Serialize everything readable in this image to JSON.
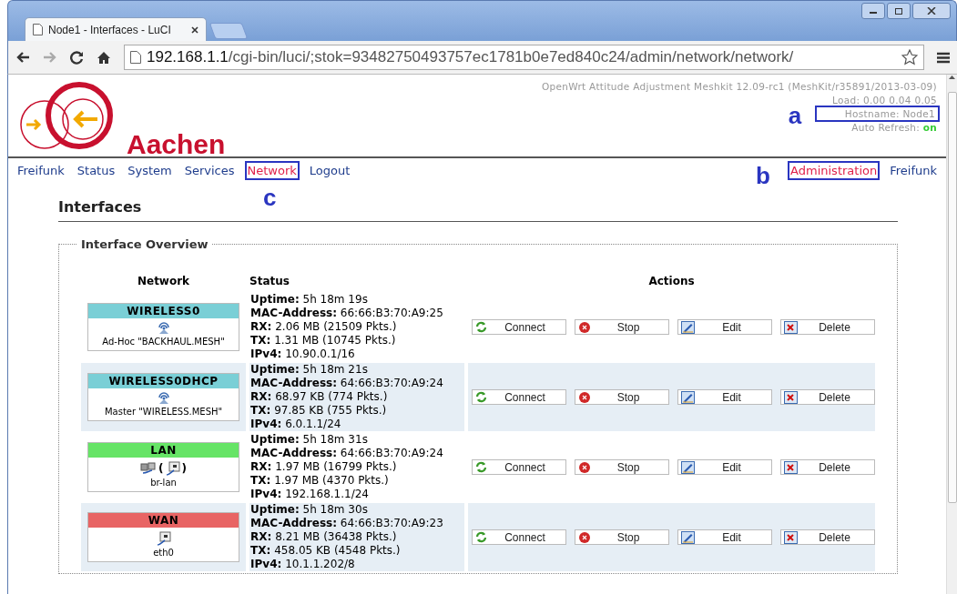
{
  "browser": {
    "tab_title": "Node1 - Interfaces - LuCI",
    "url_host": "192.168.1.1",
    "url_path": "/cgi-bin/luci/;stok=93482750493757ec1781b0e7ed840c24/admin/network/network/"
  },
  "header": {
    "logo_text": "Aachen",
    "release": "OpenWrt Attitude Adjustment Meshkit 12.09-rc1 (MeshKit/r35891/2013-03-09)",
    "load": "Load: 0.00 0.04 0.05",
    "hostname": "Hostname: Node1",
    "hostname_annotation": "a",
    "auto_refresh_label": "Auto Refresh:",
    "auto_refresh_value": "on"
  },
  "menu": {
    "left": [
      {
        "label": "Freifunk",
        "selected": false
      },
      {
        "label": "Status",
        "selected": false
      },
      {
        "label": "System",
        "selected": false
      },
      {
        "label": "Services",
        "selected": false
      },
      {
        "label": "Network",
        "selected": true,
        "annotation": "c"
      },
      {
        "label": "Logout",
        "selected": false
      }
    ],
    "right": [
      {
        "label": "Administration",
        "selected": true,
        "annotation": "b"
      },
      {
        "label": "Freifunk",
        "selected": false
      }
    ]
  },
  "page_title": "Interfaces",
  "section": {
    "legend": "Interface Overview",
    "columns": [
      "Network",
      "Status",
      "Actions"
    ],
    "rows": [
      {
        "name": "WIRELESS0",
        "color": "#7acfd6",
        "device": [
          {
            "kind": "wifi"
          }
        ],
        "subtitle": "Ad-Hoc \"BACKHAUL.MESH\"",
        "status": [
          {
            "label": "Uptime:",
            "value": "5h 18m 19s"
          },
          {
            "label": "MAC-Address:",
            "value": "66:66:B3:70:A9:25"
          },
          {
            "label": "RX:",
            "value": "2.06 MB (21509 Pkts.)"
          },
          {
            "label": "TX:",
            "value": "1.31 MB (10745 Pkts.)"
          },
          {
            "label": "IPv4:",
            "value": "10.90.0.1/16"
          }
        ],
        "actions": [
          {
            "kind": "connect",
            "label": "Connect"
          },
          {
            "kind": "stop",
            "label": "Stop"
          },
          {
            "kind": "edit",
            "label": "Edit"
          },
          {
            "kind": "delete",
            "label": "Delete"
          }
        ]
      },
      {
        "name": "WIRELESS0DHCP",
        "color": "#7acfd6",
        "device": [
          {
            "kind": "wifi"
          }
        ],
        "subtitle": "Master \"WIRELESS.MESH\"",
        "status": [
          {
            "label": "Uptime:",
            "value": "5h 18m 21s"
          },
          {
            "label": "MAC-Address:",
            "value": "64:66:B3:70:A9:24"
          },
          {
            "label": "RX:",
            "value": "68.97 KB (774 Pkts.)"
          },
          {
            "label": "TX:",
            "value": "97.85 KB (755 Pkts.)"
          },
          {
            "label": "IPv4:",
            "value": "6.0.1.1/24"
          }
        ],
        "actions": [
          {
            "kind": "connect",
            "label": "Connect"
          },
          {
            "kind": "stop",
            "label": "Stop"
          },
          {
            "kind": "edit",
            "label": "Edit"
          },
          {
            "kind": "delete",
            "label": "Delete"
          }
        ]
      },
      {
        "name": "LAN",
        "color": "#66e466",
        "device": [
          {
            "kind": "switch"
          },
          {
            "kind": "text",
            "text": "("
          },
          {
            "kind": "ethernet"
          },
          {
            "kind": "text",
            "text": ")"
          }
        ],
        "subtitle": "br-lan",
        "status": [
          {
            "label": "Uptime:",
            "value": "5h 18m 31s"
          },
          {
            "label": "MAC-Address:",
            "value": "64:66:B3:70:A9:24"
          },
          {
            "label": "RX:",
            "value": "1.97 MB (16799 Pkts.)"
          },
          {
            "label": "TX:",
            "value": "1.97 MB (4370 Pkts.)"
          },
          {
            "label": "IPv4:",
            "value": "192.168.1.1/24"
          }
        ],
        "actions": [
          {
            "kind": "connect",
            "label": "Connect"
          },
          {
            "kind": "stop",
            "label": "Stop"
          },
          {
            "kind": "edit",
            "label": "Edit"
          },
          {
            "kind": "delete",
            "label": "Delete"
          }
        ]
      },
      {
        "name": "WAN",
        "color": "#e86464",
        "device": [
          {
            "kind": "ethernet"
          }
        ],
        "subtitle": "eth0",
        "status": [
          {
            "label": "Uptime:",
            "value": "5h 18m 30s"
          },
          {
            "label": "MAC-Address:",
            "value": "64:66:B3:70:A9:23"
          },
          {
            "label": "RX:",
            "value": "8.21 MB (36438 Pkts.)"
          },
          {
            "label": "TX:",
            "value": "458.05 KB (4548 Pkts.)"
          },
          {
            "label": "IPv4:",
            "value": "10.1.1.202/8"
          }
        ],
        "actions": [
          {
            "kind": "connect",
            "label": "Connect"
          },
          {
            "kind": "stop",
            "label": "Stop"
          },
          {
            "kind": "edit",
            "label": "Edit"
          },
          {
            "kind": "delete",
            "label": "Delete"
          }
        ]
      }
    ]
  }
}
